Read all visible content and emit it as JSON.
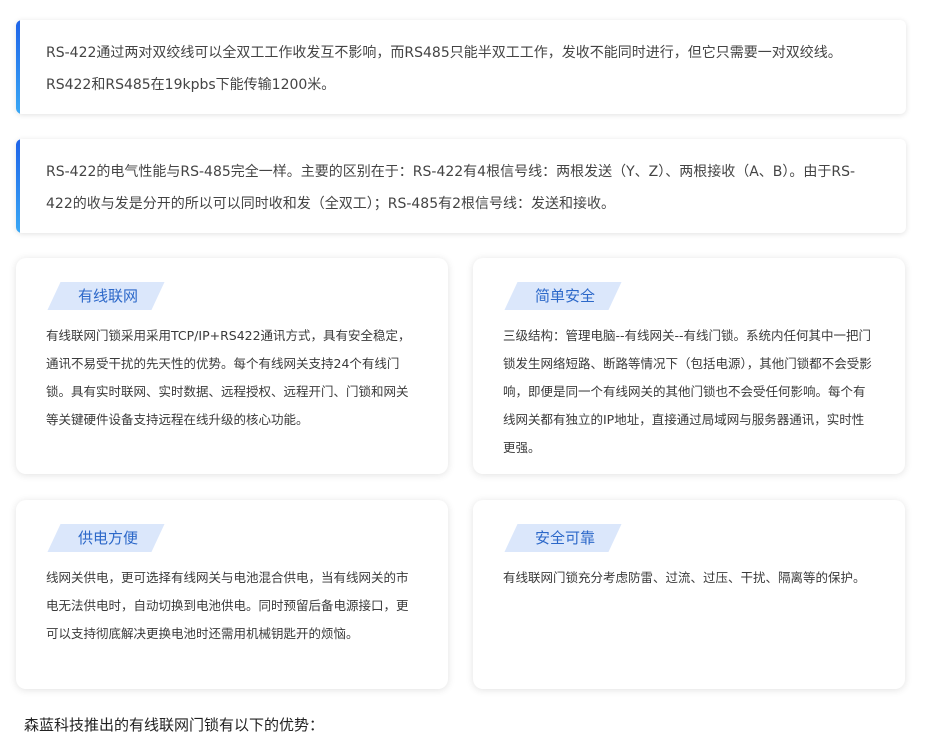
{
  "notices": [
    {
      "text": "RS-422通过两对双绞线可以全双工工作收发互不影响，而RS485只能半双工工作，发收不能同时进行，但它只需要一对双绞线。RS422和RS485在19kpbs下能传输1200米。"
    },
    {
      "text": "RS-422的电气性能与RS-485完全一样。主要的区别在于：RS-422有4根信号线：两根发送（Y、Z）、两根接收（A、B）。由于RS-422的收与发是分开的所以可以同时收和发（全双工）；RS-485有2根信号线：发送和接收。"
    }
  ],
  "cards": [
    {
      "title": "有线联网",
      "body": "有线联网门锁采用采用TCP/IP+RS422通讯方式，具有安全稳定，通讯不易受干扰的先天性的优势。每个有线网关支持24个有线门锁。具有实时联网、实时数据、远程授权、远程开门、门锁和网关等关键硬件设备支持远程在线升级的核心功能。"
    },
    {
      "title": "简单安全",
      "body": "三级结构：管理电脑--有线网关--有线门锁。系统内任何其中一把门锁发生网络短路、断路等情况下（包括电源），其他门锁都不会受影响，即便是同一个有线网关的其他门锁也不会受任何影响。每个有线网关都有独立的IP地址，直接通过局域网与服务器通讯，实时性更强。"
    },
    {
      "title": "供电方便",
      "body": "线网关供电，更可选择有线网关与电池混合供电，当有线网关的市电无法供电时，自动切换到电池供电。同时预留后备电源接口，更可以支持彻底解决更换电池时还需用机械钥匙开的烦恼。"
    },
    {
      "title": "安全可靠",
      "body": "有线联网门锁充分考虑防雷、过流、过压、干扰、隔离等的保护。"
    }
  ],
  "footer": {
    "text": "森蓝科技推出的有线联网门锁有以下的优势："
  },
  "colors": {
    "accent_gradient_top": "#1e63e8",
    "accent_gradient_bottom": "#3aa8f5",
    "tag_background": "#dbe7fb",
    "tag_text": "#2c68c9"
  }
}
